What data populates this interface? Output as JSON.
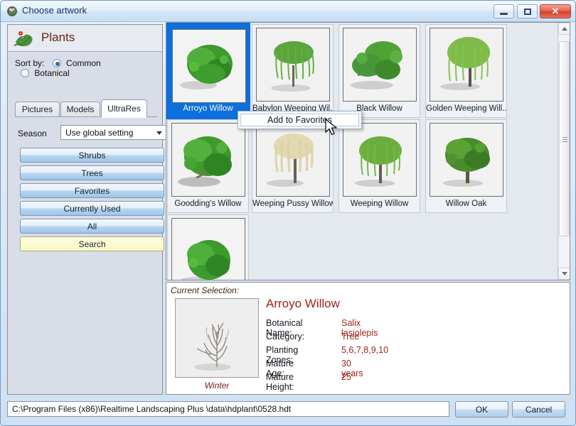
{
  "window": {
    "title": "Choose artwork",
    "icon": "plant-flower-icon",
    "minimize_label": "Minimize",
    "maximize_label": "Maximize",
    "close_label": "Close"
  },
  "sidebar": {
    "header_title": "Plants",
    "header_icon": "plant-leaves-flower-icon",
    "sort_by_label": "Sort by:",
    "sort_options": [
      {
        "label": "Common",
        "selected": true
      },
      {
        "label": "Botanical",
        "selected": false
      }
    ],
    "tabs": [
      {
        "label": "Pictures",
        "active": false
      },
      {
        "label": "Models",
        "active": false
      },
      {
        "label": "UltraRes",
        "active": true
      }
    ],
    "season_label": "Season",
    "season_value": "Use global setting",
    "category_buttons": [
      {
        "label": "Shrubs",
        "style": "blue"
      },
      {
        "label": "Trees",
        "style": "blue"
      },
      {
        "label": "Favorites",
        "style": "blue"
      },
      {
        "label": "Currently Used",
        "style": "blue"
      },
      {
        "label": "All",
        "style": "blue"
      },
      {
        "label": "Search",
        "style": "yellow"
      }
    ]
  },
  "grid": {
    "items": [
      {
        "label": "Arroyo Willow",
        "selected": true,
        "shape": "bushy-shrub",
        "color": "#3a9c2e"
      },
      {
        "label": "Babylon Weeping Wil...",
        "selected": false,
        "shape": "weeping",
        "color": "#57a33a"
      },
      {
        "label": "Black Willow",
        "selected": false,
        "shape": "broad-tree",
        "color": "#55a13a"
      },
      {
        "label": "Golden Weeping Will...",
        "selected": false,
        "shape": "weeping-tall",
        "color": "#7dba45"
      },
      {
        "label": "Goodding's Willow",
        "selected": false,
        "shape": "bushy-tree",
        "color": "#3f9b2d"
      },
      {
        "label": "Weeping Pussy Willow",
        "selected": false,
        "shape": "weeping-pale",
        "color": "#ddd2a6"
      },
      {
        "label": "Weeping Willow",
        "selected": false,
        "shape": "weeping",
        "color": "#6aad3e"
      },
      {
        "label": "Willow Oak",
        "selected": false,
        "shape": "round-tree",
        "color": "#4f8c2c"
      },
      {
        "label": "",
        "selected": false,
        "shape": "bushy-shrub",
        "color": "#3a9c2e"
      }
    ],
    "scrollbar": {
      "up_icon": "scroll-up-arrow-icon",
      "down_icon": "scroll-down-arrow-icon",
      "thumb_position_percent": 7
    }
  },
  "context_menu": {
    "items": [
      {
        "label": "Add to Favorites"
      }
    ]
  },
  "detail": {
    "current_selection_label": "Current Selection:",
    "season_caption": "Winter",
    "plant_name": "Arroyo Willow",
    "fields": [
      {
        "key": "Botanical Name:",
        "value": "Salix lasiolepis"
      },
      {
        "key": "Category:",
        "value": "Tree"
      },
      {
        "key": "Planting Zones:",
        "value": "5,6,7,8,9,10"
      },
      {
        "key": "Mature Age:",
        "value": "30 years"
      },
      {
        "key": "Mature Height:",
        "value": "25'"
      }
    ]
  },
  "footer": {
    "path": "C:\\Program Files (x86)\\Realtime Landscaping Plus \\data\\hdplant\\0528.hdt",
    "ok_label": "OK",
    "cancel_label": "Cancel"
  },
  "colors": {
    "selection_blue": "#0b6fdd",
    "detail_red": "#9c2318",
    "title_text": "#11335e",
    "search_yellow": "#fbfbd2"
  }
}
